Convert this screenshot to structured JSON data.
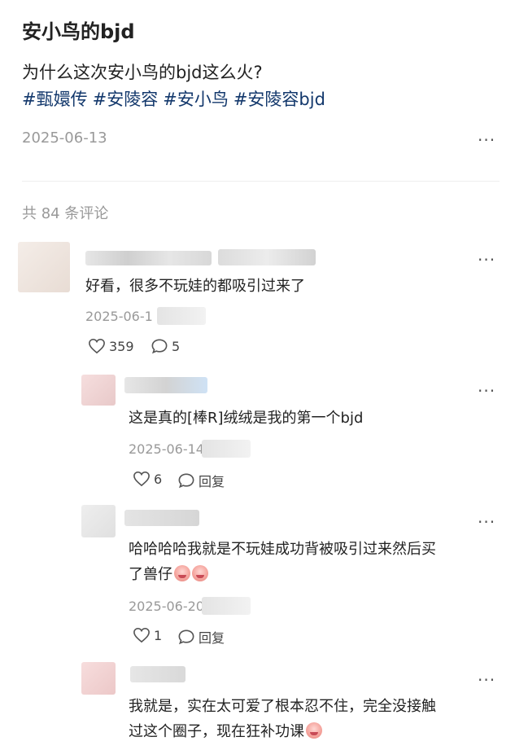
{
  "post": {
    "title": "安小鸟的bjd",
    "question": "为什么这次安小鸟的bjd这么火?",
    "tags": [
      "#甄嬛传",
      "#安陵容",
      "#安小鸟",
      "#安陵容bjd"
    ],
    "date": "2025-06-13",
    "more_icon": "more-horizontal-icon"
  },
  "comments_header": {
    "count_text": "共 84 条评论"
  },
  "comments": [
    {
      "text": "好看，很多不玩娃的都吸引过来了",
      "date_visible": "2025-06-1",
      "likes": "359",
      "replies": "5"
    }
  ],
  "replies": [
    {
      "text": "这是真的[棒R]绒绒是我的第一个bjd",
      "date_visible": "2025-06-14",
      "likes": "6",
      "reply_label": "回复"
    },
    {
      "text_line1": "哈哈哈哈我就是不玩娃成功背被吸引过来然后买",
      "text_line2": "了兽仔",
      "date_visible": "2025-06-20",
      "likes": "1",
      "reply_label": "回复",
      "emoji_icon": "crying-face-emoji-icon"
    },
    {
      "text_line1": "我就是，实在太可爱了根本忍不住，完全没接触",
      "text_line2": "过这个圈子，现在狂补功课",
      "emoji_icon": "peach-face-emoji-icon"
    }
  ],
  "colors": {
    "tag": "#13386c",
    "muted": "#999999",
    "text": "#222222",
    "divider": "#eeeeee"
  }
}
